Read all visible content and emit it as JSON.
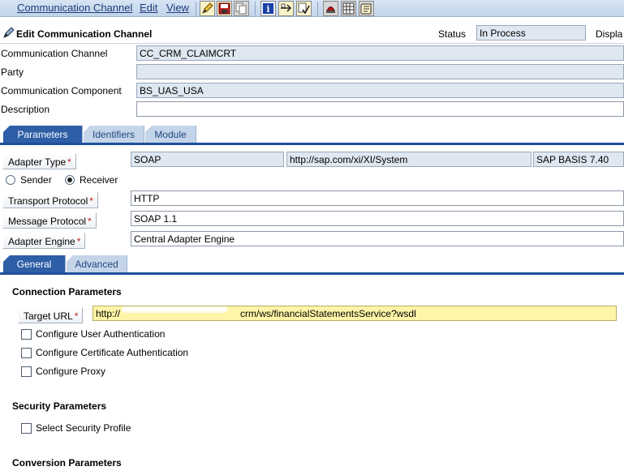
{
  "menu": {
    "items": [
      "Communication Channel",
      "Edit",
      "View"
    ]
  },
  "toolbar": {
    "icons": [
      "change-icon",
      "save-icon",
      "copy-icon",
      "info-icon",
      "assign-icon",
      "check-icon",
      "cancel-icon",
      "table-icon",
      "log-icon"
    ]
  },
  "header": {
    "title": "Edit Communication Channel",
    "status_label": "Status",
    "status_value": "In Process",
    "display_label": "Displa"
  },
  "fields": {
    "channel_label": "Communication Channel",
    "channel_value": "CC_CRM_CLAIMCRT",
    "party_label": "Party",
    "party_value": "",
    "component_label": "Communication Component",
    "component_value": "BS_UAS_USA",
    "description_label": "Description",
    "description_value": ""
  },
  "main_tabs": [
    "Parameters",
    "Identifiers",
    "Module"
  ],
  "parameters": {
    "adapter_type_label": "Adapter Type",
    "adapter_type_value": "SOAP",
    "adapter_namespace": "http://sap.com/xi/XI/System",
    "adapter_release": "SAP BASIS 7.40",
    "sender_label": "Sender",
    "receiver_label": "Receiver",
    "direction_selected": "Receiver",
    "transport_label": "Transport Protocol",
    "transport_value": "HTTP",
    "message_label": "Message Protocol",
    "message_value": "SOAP 1.1",
    "engine_label": "Adapter Engine",
    "engine_value": "Central Adapter Engine",
    "required_mark": "*"
  },
  "sub_tabs": [
    "General",
    "Advanced"
  ],
  "connection": {
    "heading": "Connection Parameters",
    "target_url_label": "Target URL",
    "target_url_value": "http://                              /crm/ws/financialStatementsService?wsdl",
    "target_url_prefix": "http://",
    "target_url_suffix": "crm/ws/financialStatementsService?wsdl",
    "configure_user_auth": "Configure User Authentication",
    "configure_cert_auth": "Configure Certificate Authentication",
    "configure_proxy": "Configure Proxy"
  },
  "security": {
    "heading": "Security Parameters",
    "select_profile": "Select Security Profile"
  },
  "conversion": {
    "heading": "Conversion Parameters"
  },
  "colors": {
    "tab_active": "#2d5ea6",
    "tab_inactive": "#c4d5ea",
    "field_readonly": "#dfe7f1",
    "field_highlight": "#fff5a8",
    "required": "#c01818"
  }
}
